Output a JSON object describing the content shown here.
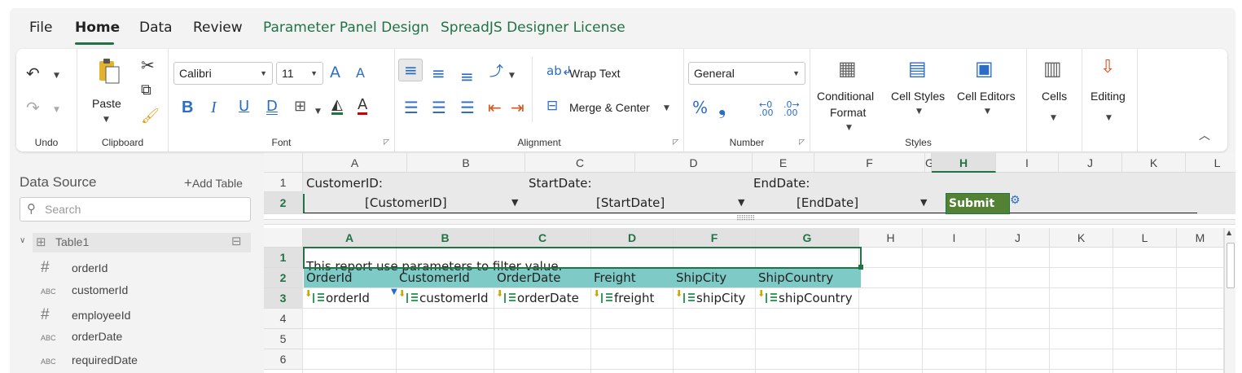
{
  "menu": {
    "items": [
      {
        "label": "File"
      },
      {
        "label": "Home"
      },
      {
        "label": "Data"
      },
      {
        "label": "Review"
      },
      {
        "label": "Parameter Panel Design"
      },
      {
        "label": "SpreadJS Designer License"
      }
    ],
    "active": "Home"
  },
  "ribbon": {
    "undo": {
      "label": "Undo"
    },
    "clipboard": {
      "label": "Clipboard",
      "paste": "Paste"
    },
    "font": {
      "label": "Font",
      "family": "Calibri",
      "size": "11",
      "bold": "B",
      "italic": "I",
      "underline": "U",
      "double_underline": "D"
    },
    "alignment": {
      "label": "Alignment",
      "wrap": "Wrap Text",
      "merge": "Merge & Center"
    },
    "number": {
      "label": "Number",
      "format": "General",
      "percent": "%",
      "comma": "❟",
      "inc_decimal": ".00",
      "dec_decimal": ".00"
    },
    "styles": {
      "label": "Styles",
      "conditional": "Conditional",
      "conditional2": "Format",
      "cell_styles": "Cell Styles",
      "cell_editors": "Cell Editors"
    },
    "cells": {
      "label": "Cells"
    },
    "editing": {
      "label": "Editing"
    }
  },
  "data_source": {
    "title": "Data Source",
    "add_table": "Add Table",
    "search_placeholder": "Search",
    "table": "Table1",
    "fields": [
      {
        "icon": "#",
        "name": "orderId"
      },
      {
        "icon": "ABC",
        "name": "customerId"
      },
      {
        "icon": "#",
        "name": "employeeId"
      },
      {
        "icon": "ABC",
        "name": "orderDate"
      },
      {
        "icon": "ABC",
        "name": "requiredDate"
      }
    ]
  },
  "param_panel": {
    "columns": [
      "A",
      "B",
      "C",
      "D",
      "E",
      "F",
      "G",
      "H",
      "I",
      "J",
      "K",
      "L"
    ],
    "rows": [
      "1",
      "2"
    ],
    "labels": {
      "customer": "CustomerID:",
      "start": "StartDate:",
      "end": "EndDate:"
    },
    "values": {
      "customer": "[CustomerID]",
      "start": "[StartDate]",
      "end": "[EndDate]"
    },
    "submit": "Submit"
  },
  "report_sheet": {
    "columns": [
      "A",
      "B",
      "C",
      "D",
      "F",
      "G",
      "H",
      "I",
      "J",
      "K",
      "L",
      "M"
    ],
    "rows": [
      "1",
      "2",
      "3",
      "4",
      "5",
      "6"
    ],
    "title": "This report use parameters to filter value.",
    "headers": [
      "OrderId",
      "CustomerId",
      "OrderDate",
      "Freight",
      "ShipCity",
      "ShipCountry"
    ],
    "bindings": [
      "orderId",
      "customerId",
      "orderDate",
      "freight",
      "shipCity",
      "shipCountry"
    ]
  },
  "colors": {
    "accent": "#217346",
    "teal": "#7ecac6",
    "submit": "#548235"
  }
}
